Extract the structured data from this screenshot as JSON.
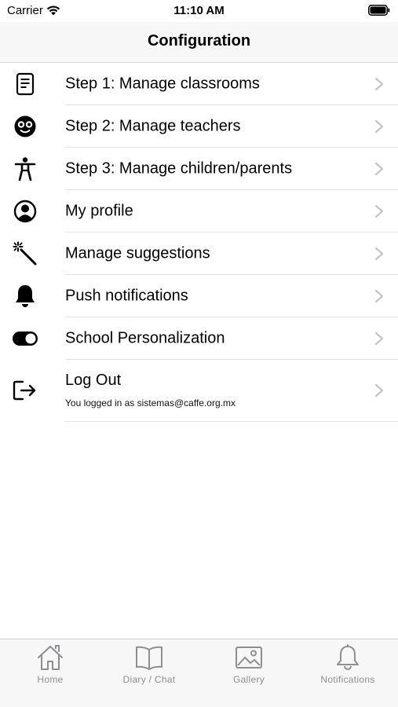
{
  "status_bar": {
    "carrier": "Carrier",
    "time": "11:10 AM"
  },
  "nav": {
    "title": "Configuration"
  },
  "menu": {
    "items": [
      {
        "label": "Step 1: Manage classrooms",
        "icon": "document-icon"
      },
      {
        "label": "Step 2: Manage teachers",
        "icon": "teacher-face-icon"
      },
      {
        "label": "Step 3: Manage children/parents",
        "icon": "person-figure-icon"
      },
      {
        "label": "My profile",
        "icon": "profile-circle-icon"
      },
      {
        "label": "Manage suggestions",
        "icon": "magic-wand-icon"
      },
      {
        "label": "Push notifications",
        "icon": "bell-icon"
      },
      {
        "label": "School Personalization",
        "icon": "toggle-icon"
      }
    ],
    "logout": {
      "label": "Log Out",
      "subtitle": "You logged in as sistemas@caffe.org.mx",
      "icon": "logout-icon"
    }
  },
  "tab_bar": {
    "tabs": [
      {
        "label": "Home",
        "icon": "home-icon"
      },
      {
        "label": "Diary / Chat",
        "icon": "book-icon"
      },
      {
        "label": "Gallery",
        "icon": "image-icon"
      },
      {
        "label": "Notifications",
        "icon": "bell-outline-icon"
      }
    ],
    "inactive_color": "#8e8e93"
  }
}
